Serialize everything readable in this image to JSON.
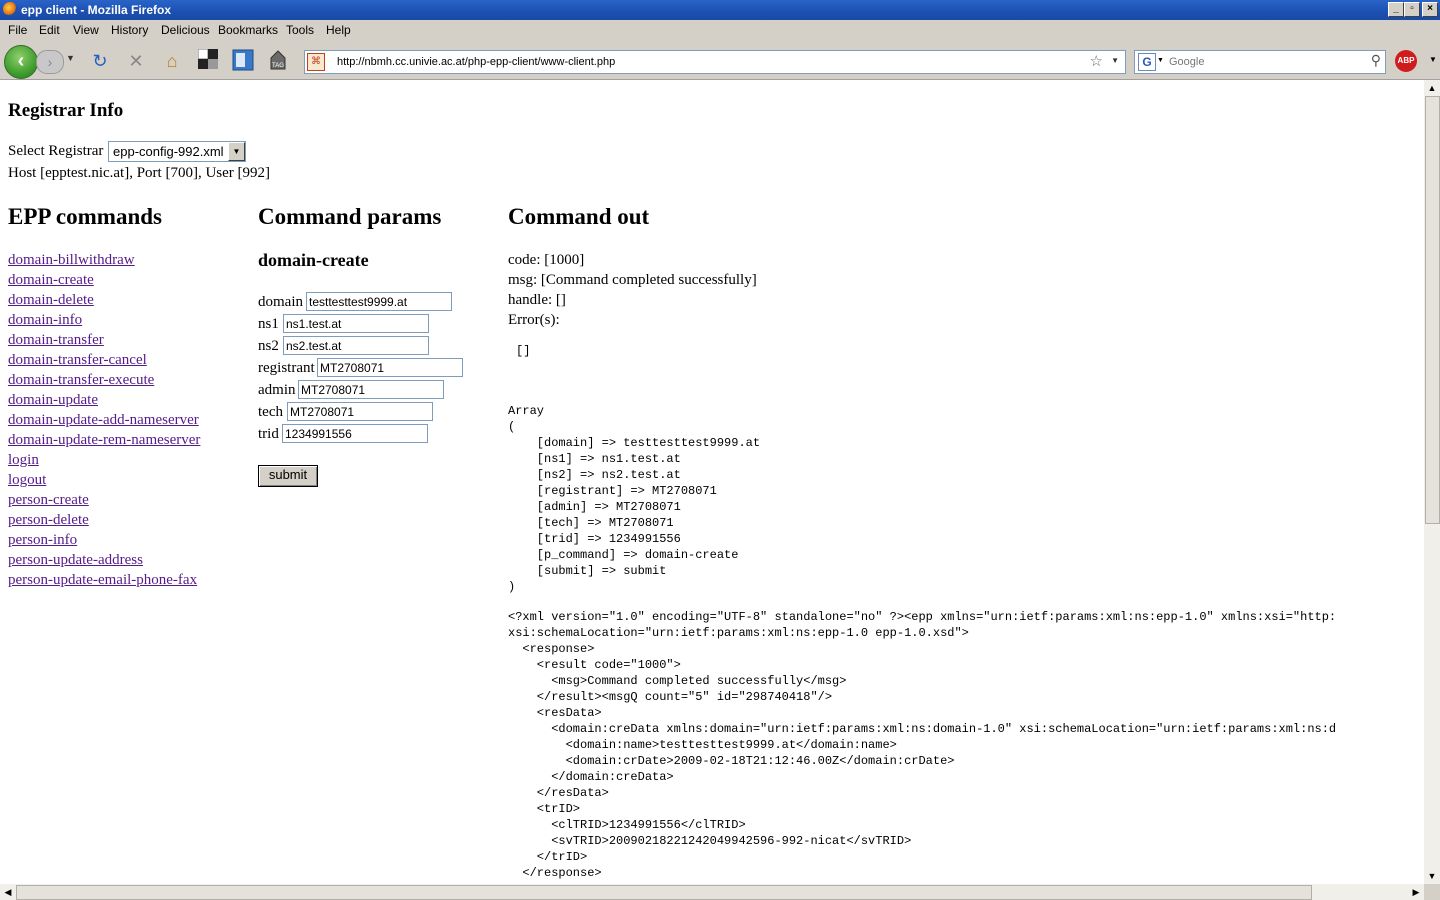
{
  "window": {
    "title": "epp client - Mozilla Firefox"
  },
  "menu": [
    "File",
    "Edit",
    "View",
    "History",
    "Delicious",
    "Bookmarks",
    "Tools",
    "Help"
  ],
  "address": "http://nbmh.cc.univie.ac.at/php-epp-client/www-client.php",
  "search_placeholder": "Google",
  "page": {
    "registrar_heading": "Registrar Info",
    "select_label": "Select Registrar",
    "select_value": "epp-config-992.xml",
    "host_line": "Host [epptest.nic.at], Port [700], User [992]",
    "commands_heading": "EPP commands",
    "params_heading": "Command params",
    "out_heading": "Command out",
    "commands": [
      "domain-billwithdraw",
      "domain-create",
      "domain-delete",
      "domain-info",
      "domain-transfer",
      "domain-transfer-cancel",
      "domain-transfer-execute",
      "domain-update",
      "domain-update-add-nameserver",
      "domain-update-rem-nameserver",
      "login",
      "logout",
      "person-create",
      "person-delete",
      "person-info",
      "person-update-address",
      "person-update-email-phone-fax"
    ],
    "current_command": "domain-create",
    "fields": [
      {
        "label": "domain",
        "value": "testtesttest9999.at"
      },
      {
        "label": "ns1",
        "value": "ns1.test.at"
      },
      {
        "label": "ns2",
        "value": "ns2.test.at"
      },
      {
        "label": "registrant",
        "value": "MT2708071"
      },
      {
        "label": "admin",
        "value": "MT2708071"
      },
      {
        "label": "tech",
        "value": "MT2708071"
      },
      {
        "label": "trid",
        "value": "1234991556"
      }
    ],
    "submit_label": "submit",
    "out_lines": [
      "code: [1000]",
      "msg: [Command completed successfully]",
      "handle: []",
      "Error(s):"
    ],
    "errors_pre": "[]",
    "array_pre": "Array\n(\n    [domain] => testtesttest9999.at\n    [ns1] => ns1.test.at\n    [ns2] => ns2.test.at\n    [registrant] => MT2708071\n    [admin] => MT2708071\n    [tech] => MT2708071\n    [trid] => 1234991556\n    [p_command] => domain-create\n    [submit] => submit\n)",
    "xml_pre": "<?xml version=\"1.0\" encoding=\"UTF-8\" standalone=\"no\" ?><epp xmlns=\"urn:ietf:params:xml:ns:epp-1.0\" xmlns:xsi=\"http:\nxsi:schemaLocation=\"urn:ietf:params:xml:ns:epp-1.0 epp-1.0.xsd\">\n  <response>\n    <result code=\"1000\">\n      <msg>Command completed successfully</msg>\n    </result><msgQ count=\"5\" id=\"298740418\"/>\n    <resData>\n      <domain:creData xmlns:domain=\"urn:ietf:params:xml:ns:domain-1.0\" xsi:schemaLocation=\"urn:ietf:params:xml:ns:d\n        <domain:name>testtesttest9999.at</domain:name>\n        <domain:crDate>2009-02-18T21:12:46.00Z</domain:crDate>\n      </domain:creData>\n    </resData>\n    <trID>\n      <clTRID>1234991556</clTRID>\n      <svTRID>20090218221242049942596-992-nicat</svTRID>\n    </trID>\n  </response>"
  }
}
